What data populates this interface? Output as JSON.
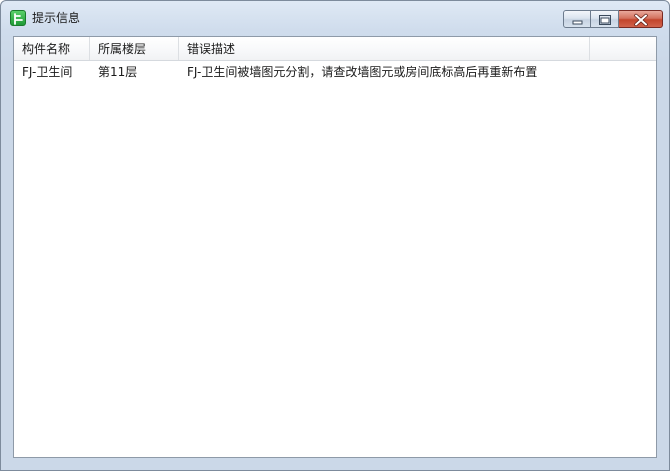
{
  "window": {
    "title": "提示信息"
  },
  "caption_buttons": {
    "minimize_icon": "minimize-icon",
    "maximize_icon": "maximize-icon",
    "close_icon": "close-icon"
  },
  "table": {
    "columns": [
      "构件名称",
      "所属楼层",
      "错误描述"
    ],
    "rows": [
      {
        "name": "FJ-卫生间",
        "floor": "第11层",
        "description": "FJ-卫生间被墙图元分割，请查改墙图元或房间底标高后再重新布置"
      }
    ]
  },
  "colors": {
    "app_icon": "#2fae48",
    "close_button": "#c2452c",
    "frame": "#cbd8e8"
  }
}
